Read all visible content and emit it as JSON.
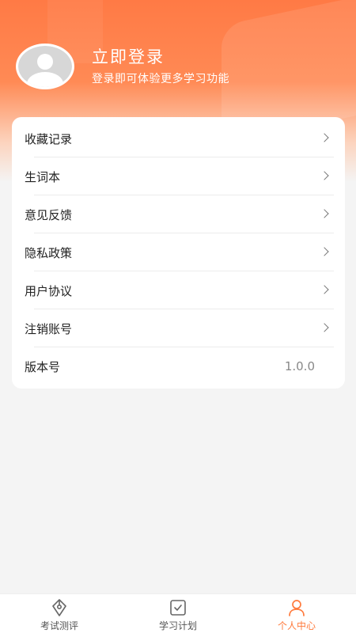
{
  "profile": {
    "title": "立即登录",
    "subtitle": "登录即可体验更多学习功能"
  },
  "menu": {
    "items": [
      {
        "label": "收藏记录"
      },
      {
        "label": "生词本"
      },
      {
        "label": "意见反馈"
      },
      {
        "label": "隐私政策"
      },
      {
        "label": "用户协议"
      },
      {
        "label": "注销账号"
      }
    ],
    "version_label": "版本号",
    "version_value": "1.0.0"
  },
  "tabs": [
    {
      "label": "考试测评",
      "icon": "exam-pen-icon"
    },
    {
      "label": "学习计划",
      "icon": "plan-check-icon"
    },
    {
      "label": "个人中心",
      "icon": "user-icon",
      "active": true
    }
  ],
  "colors": {
    "accent": "#ff7a3c",
    "header_gradient_top": "#ff7a45",
    "background": "#f4f4f4"
  }
}
